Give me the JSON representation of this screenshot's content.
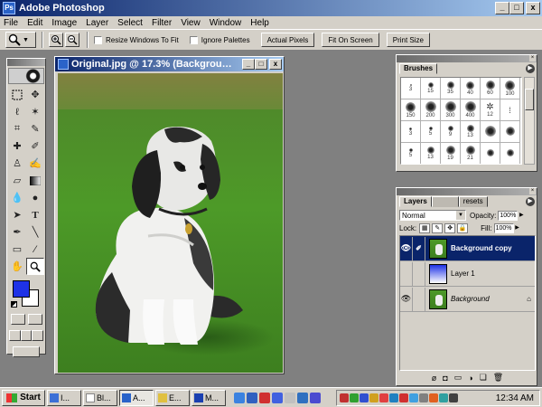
{
  "app": {
    "title": "Adobe Photoshop",
    "icon_name": "photoshop-icon"
  },
  "window_buttons": {
    "minimize": "_",
    "maximize": "□",
    "close": "x"
  },
  "menu": [
    {
      "label": "File"
    },
    {
      "label": "Edit"
    },
    {
      "label": "Image"
    },
    {
      "label": "Layer"
    },
    {
      "label": "Select"
    },
    {
      "label": "Filter"
    },
    {
      "label": "View"
    },
    {
      "label": "Window"
    },
    {
      "label": "Help"
    }
  ],
  "options_bar": {
    "tool_icon": "zoom-icon",
    "resize_label": "Resize Windows To Fit",
    "ignore_label": "Ignore Palettes",
    "actual_pixels": "Actual Pixels",
    "fit_on_screen": "Fit On Screen",
    "print_size": "Print Size"
  },
  "document": {
    "title": "Original.jpg @ 17.3% (Backgrou…"
  },
  "brushes": {
    "tab": "Brushes",
    "rows": [
      [
        "3",
        "15",
        "35",
        "40",
        "60",
        "100"
      ],
      [
        "150",
        "200",
        "300",
        "400",
        "12",
        ""
      ],
      [
        "3",
        "5",
        "9",
        "13",
        "",
        ""
      ],
      [
        "5",
        "13",
        "19",
        "21",
        "",
        ""
      ]
    ]
  },
  "layers": {
    "tab_layers": "Layers",
    "tab_other": "resets",
    "blend_mode": "Normal",
    "opacity_label": "Opacity:",
    "opacity_value": "100%",
    "lock_label": "Lock:",
    "fill_label": "Fill:",
    "fill_value": "100%",
    "items": [
      {
        "name": "Background copy",
        "active": true
      },
      {
        "name": "Layer 1",
        "active": false
      },
      {
        "name": "Background",
        "active": false
      }
    ]
  },
  "taskbar": {
    "start": "Start",
    "tasks": [
      {
        "label": "I..."
      },
      {
        "label": "Bl..."
      },
      {
        "label": "A..."
      },
      {
        "label": "E..."
      },
      {
        "label": "M..."
      }
    ],
    "clock": "12:34 AM"
  },
  "colors": {
    "title_gradient_start": "#0a246a",
    "title_gradient_end": "#a6caf0",
    "foreground_color": "#1e32e6",
    "background_color": "#ffffff",
    "chrome": "#d4d0c8",
    "workspace": "#808080"
  }
}
